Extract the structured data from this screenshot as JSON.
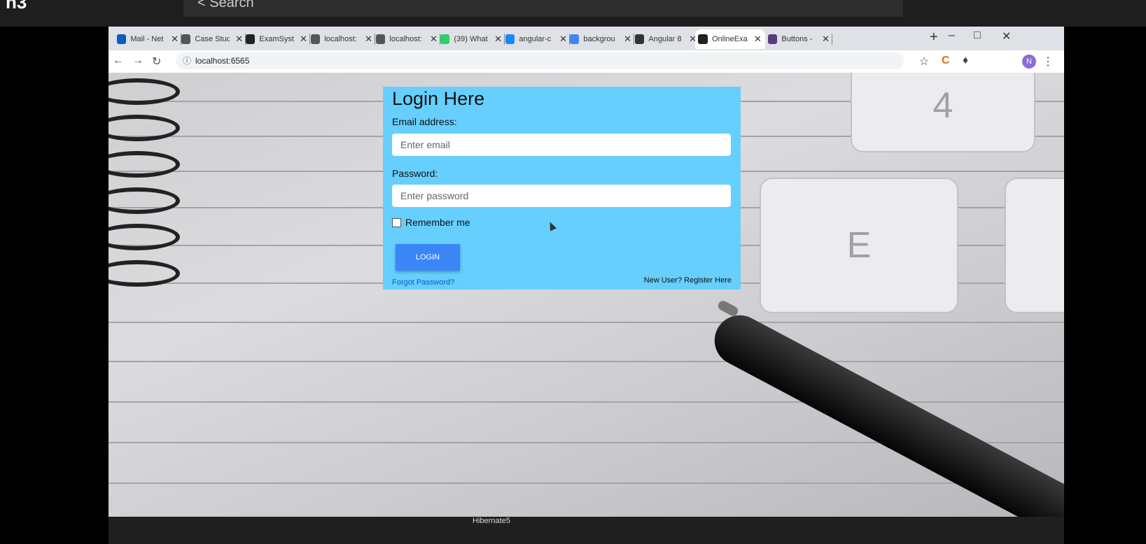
{
  "outer": {
    "logo": "n3",
    "search_text": "< Search"
  },
  "browser": {
    "tabs": [
      {
        "label": "Mail - Net",
        "icon": "outlook-icon",
        "color": "#0a5cc2"
      },
      {
        "label": "Case Studi",
        "icon": "globe-icon",
        "color": "#555555"
      },
      {
        "label": "ExamSyste",
        "icon": "angular-icon",
        "color": "#222222"
      },
      {
        "label": "localhost:",
        "icon": "globe-icon",
        "color": "#555555"
      },
      {
        "label": "localhost:",
        "icon": "globe-icon",
        "color": "#555555"
      },
      {
        "label": "(39) What",
        "icon": "whatsapp-icon",
        "color": "#25d366"
      },
      {
        "label": "angular-c",
        "icon": "stackblitz-icon",
        "color": "#1389fd"
      },
      {
        "label": "backgrou",
        "icon": "google-icon",
        "color": "#4285f4"
      },
      {
        "label": "Angular 8",
        "icon": "angular-book-icon",
        "color": "#333333"
      },
      {
        "label": "OnlineExa",
        "icon": "angular-icon",
        "color": "#222222"
      },
      {
        "label": "Buttons -",
        "icon": "bootstrap-icon",
        "color": "#563d7c"
      }
    ],
    "active_tab_index": 9,
    "url": "localhost:6565",
    "avatar_letter": "N"
  },
  "login": {
    "title": "Login Here",
    "email_label": "Email address:",
    "email_placeholder": "Enter email",
    "password_label": "Password:",
    "password_placeholder": "Enter password",
    "remember_label": "Remember me",
    "login_button": "LOGIN",
    "forgot_link": "Forgot Password?",
    "register_link": "New User? Register Here"
  },
  "taskbar": {
    "item": "Hibernate5"
  }
}
